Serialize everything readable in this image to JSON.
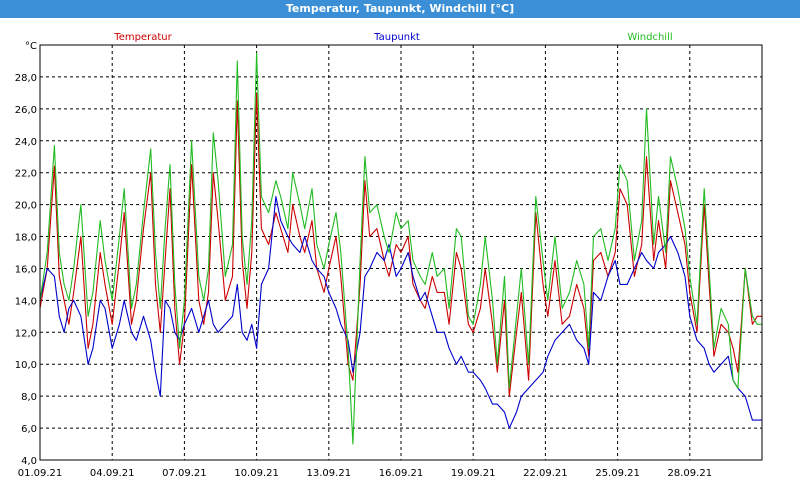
{
  "window": {
    "title": "Temperatur, Taupunkt, Windchill [°C]"
  },
  "chart_data": {
    "type": "line",
    "unit": "°C",
    "ylim": [
      4.0,
      30.0
    ],
    "yticks": [
      "4,0",
      "6,0",
      "8,0",
      "10,0",
      "12,0",
      "14,0",
      "16,0",
      "18,0",
      "20,0",
      "22,0",
      "24,0",
      "26,0",
      "28,0"
    ],
    "xlim_days": [
      1,
      31
    ],
    "xticks": [
      "01.09.21",
      "04.09.21",
      "07.09.21",
      "10.09.21",
      "13.09.21",
      "16.09.21",
      "19.09.21",
      "22.09.21",
      "25.09.21",
      "28.09.21"
    ],
    "grid": true,
    "legend_placement": "top",
    "series": [
      {
        "name": "Temperatur",
        "color": "#cc0000",
        "x": [
          1.0,
          1.3,
          1.6,
          1.8,
          2.0,
          2.2,
          2.4,
          2.7,
          3.0,
          3.2,
          3.5,
          3.7,
          4.0,
          4.3,
          4.5,
          4.8,
          5.0,
          5.3,
          5.6,
          5.8,
          6.0,
          6.2,
          6.4,
          6.6,
          6.8,
          7.0,
          7.3,
          7.6,
          7.8,
          8.0,
          8.2,
          8.4,
          8.7,
          9.0,
          9.2,
          9.4,
          9.6,
          9.8,
          10.0,
          10.2,
          10.5,
          10.8,
          11.0,
          11.3,
          11.5,
          11.8,
          12.0,
          12.3,
          12.5,
          12.8,
          13.0,
          13.3,
          13.5,
          13.8,
          14.0,
          14.3,
          14.5,
          14.7,
          15.0,
          15.3,
          15.5,
          15.8,
          16.0,
          16.3,
          16.5,
          16.8,
          17.0,
          17.3,
          17.5,
          17.8,
          18.0,
          18.3,
          18.5,
          18.8,
          19.0,
          19.3,
          19.5,
          19.8,
          20.0,
          20.3,
          20.5,
          20.8,
          21.0,
          21.3,
          21.6,
          21.9,
          22.1,
          22.4,
          22.7,
          23.0,
          23.3,
          23.6,
          23.8,
          24.0,
          24.3,
          24.6,
          24.9,
          25.1,
          25.4,
          25.7,
          26.0,
          26.2,
          26.5,
          26.7,
          27.0,
          27.2,
          27.5,
          27.8,
          28.0,
          28.3,
          28.6,
          28.8,
          29.0,
          29.3,
          29.6,
          29.8,
          30.0,
          30.3,
          30.6,
          30.8,
          31.0
        ],
        "y": [
          13.5,
          16.0,
          22.4,
          15.5,
          14.0,
          12.5,
          14.5,
          18.0,
          11.0,
          12.5,
          17.0,
          15.0,
          12.5,
          16.5,
          19.5,
          12.5,
          14.0,
          18.5,
          22.0,
          15.0,
          12.0,
          16.5,
          21.0,
          13.5,
          10.0,
          12.5,
          22.5,
          14.0,
          12.5,
          14.5,
          22.0,
          19.0,
          14.0,
          15.5,
          26.5,
          16.5,
          13.5,
          17.0,
          27.0,
          18.5,
          17.5,
          19.5,
          18.5,
          17.0,
          20.0,
          18.0,
          17.0,
          19.0,
          16.0,
          14.5,
          16.0,
          18.0,
          15.5,
          10.0,
          9.0,
          15.0,
          21.5,
          18.0,
          18.5,
          16.5,
          15.5,
          17.5,
          17.0,
          18.0,
          15.0,
          14.0,
          13.5,
          15.5,
          14.5,
          14.5,
          12.5,
          17.0,
          16.0,
          12.5,
          12.0,
          13.5,
          16.0,
          12.5,
          9.5,
          14.0,
          8.0,
          12.0,
          14.5,
          9.0,
          19.5,
          15.0,
          13.0,
          16.5,
          12.5,
          13.0,
          15.0,
          13.5,
          10.5,
          16.5,
          17.0,
          15.5,
          17.0,
          21.0,
          20.0,
          15.5,
          17.5,
          23.0,
          16.5,
          19.0,
          16.0,
          21.5,
          19.5,
          17.5,
          14.5,
          12.0,
          20.0,
          15.0,
          10.5,
          12.5,
          12.0,
          11.0,
          9.5,
          16.0,
          12.5,
          13.0,
          13.0
        ]
      },
      {
        "name": "Taupunkt",
        "color": "#0000cc",
        "x": [
          1.0,
          1.3,
          1.6,
          1.8,
          2.0,
          2.2,
          2.4,
          2.7,
          3.0,
          3.2,
          3.5,
          3.7,
          4.0,
          4.3,
          4.5,
          4.8,
          5.0,
          5.3,
          5.6,
          5.8,
          6.0,
          6.2,
          6.4,
          6.6,
          6.8,
          7.0,
          7.3,
          7.6,
          7.8,
          8.0,
          8.2,
          8.4,
          8.7,
          9.0,
          9.2,
          9.4,
          9.6,
          9.8,
          10.0,
          10.2,
          10.5,
          10.8,
          11.0,
          11.3,
          11.5,
          11.8,
          12.0,
          12.3,
          12.5,
          12.8,
          13.0,
          13.3,
          13.5,
          13.8,
          14.0,
          14.3,
          14.5,
          14.7,
          15.0,
          15.3,
          15.5,
          15.8,
          16.0,
          16.3,
          16.5,
          16.8,
          17.0,
          17.3,
          17.5,
          17.8,
          18.0,
          18.3,
          18.5,
          18.8,
          19.0,
          19.3,
          19.5,
          19.8,
          20.0,
          20.3,
          20.5,
          20.8,
          21.0,
          21.3,
          21.6,
          21.9,
          22.1,
          22.4,
          22.7,
          23.0,
          23.3,
          23.6,
          23.8,
          24.0,
          24.3,
          24.6,
          24.9,
          25.1,
          25.4,
          25.7,
          26.0,
          26.2,
          26.5,
          26.7,
          27.0,
          27.2,
          27.5,
          27.8,
          28.0,
          28.3,
          28.6,
          28.8,
          29.0,
          29.3,
          29.6,
          29.8,
          30.0,
          30.3,
          30.6,
          30.8,
          31.0
        ],
        "y": [
          14.0,
          16.0,
          15.5,
          13.0,
          12.0,
          13.5,
          14.0,
          13.0,
          10.0,
          11.0,
          14.0,
          13.5,
          11.0,
          12.5,
          14.0,
          12.0,
          11.5,
          13.0,
          11.5,
          9.5,
          8.0,
          14.0,
          13.5,
          12.0,
          11.5,
          12.5,
          13.5,
          12.0,
          13.0,
          14.0,
          12.5,
          12.0,
          12.5,
          13.0,
          15.0,
          12.0,
          11.5,
          12.5,
          11.0,
          15.0,
          16.0,
          20.5,
          19.0,
          18.0,
          17.5,
          17.0,
          18.0,
          16.5,
          16.0,
          15.5,
          14.5,
          13.5,
          12.5,
          11.5,
          9.5,
          12.0,
          15.5,
          16.0,
          17.0,
          16.5,
          17.5,
          15.5,
          16.0,
          17.0,
          15.5,
          14.0,
          14.5,
          13.0,
          12.0,
          12.0,
          11.0,
          10.0,
          10.5,
          9.5,
          9.5,
          9.0,
          8.5,
          7.5,
          7.5,
          7.0,
          6.0,
          7.0,
          8.0,
          8.5,
          9.0,
          9.5,
          10.5,
          11.5,
          12.0,
          12.5,
          11.5,
          11.0,
          10.0,
          14.5,
          14.0,
          15.5,
          16.5,
          15.0,
          15.0,
          16.0,
          17.0,
          16.5,
          16.0,
          17.0,
          17.5,
          18.0,
          17.0,
          15.5,
          13.0,
          11.5,
          11.0,
          10.0,
          9.5,
          10.0,
          10.5,
          9.0,
          8.5,
          8.0,
          6.5,
          6.5,
          6.5
        ]
      },
      {
        "name": "Windchill",
        "color": "#22bb22",
        "x": [
          1.0,
          1.3,
          1.6,
          1.8,
          2.0,
          2.2,
          2.4,
          2.7,
          3.0,
          3.2,
          3.5,
          3.7,
          4.0,
          4.3,
          4.5,
          4.8,
          5.0,
          5.3,
          5.6,
          5.8,
          6.0,
          6.2,
          6.4,
          6.6,
          6.8,
          7.0,
          7.3,
          7.6,
          7.8,
          8.0,
          8.2,
          8.4,
          8.7,
          9.0,
          9.2,
          9.4,
          9.6,
          9.8,
          10.0,
          10.2,
          10.5,
          10.8,
          11.0,
          11.3,
          11.5,
          11.8,
          12.0,
          12.3,
          12.5,
          12.8,
          13.0,
          13.3,
          13.5,
          13.8,
          14.0,
          14.3,
          14.5,
          14.7,
          15.0,
          15.3,
          15.5,
          15.8,
          16.0,
          16.3,
          16.5,
          16.8,
          17.0,
          17.3,
          17.5,
          17.8,
          18.0,
          18.3,
          18.5,
          18.8,
          19.0,
          19.3,
          19.5,
          19.8,
          20.0,
          20.3,
          20.5,
          20.8,
          21.0,
          21.3,
          21.6,
          21.9,
          22.1,
          22.4,
          22.7,
          23.0,
          23.3,
          23.6,
          23.8,
          24.0,
          24.3,
          24.6,
          24.9,
          25.1,
          25.4,
          25.7,
          26.0,
          26.2,
          26.5,
          26.7,
          27.0,
          27.2,
          27.5,
          27.8,
          28.0,
          28.3,
          28.6,
          28.8,
          29.0,
          29.3,
          29.6,
          29.8,
          30.0,
          30.3,
          30.6,
          30.8,
          31.0
        ],
        "y": [
          14.0,
          17.0,
          23.7,
          17.0,
          15.0,
          14.0,
          16.0,
          20.0,
          13.0,
          14.5,
          19.0,
          16.5,
          14.0,
          18.0,
          21.0,
          13.5,
          15.0,
          19.5,
          23.5,
          17.0,
          13.5,
          18.5,
          22.5,
          15.0,
          11.0,
          14.0,
          24.0,
          15.5,
          14.0,
          16.0,
          24.5,
          21.5,
          15.5,
          17.5,
          29.0,
          18.0,
          15.0,
          19.0,
          29.5,
          20.5,
          19.5,
          21.5,
          20.5,
          18.5,
          22.0,
          20.0,
          18.5,
          21.0,
          17.5,
          16.0,
          17.5,
          19.5,
          17.0,
          11.0,
          5.0,
          16.5,
          23.0,
          19.5,
          20.0,
          18.0,
          17.0,
          19.5,
          18.5,
          19.0,
          16.5,
          15.5,
          15.0,
          17.0,
          15.5,
          16.0,
          13.5,
          18.5,
          18.0,
          13.0,
          12.5,
          15.0,
          18.0,
          14.0,
          10.0,
          15.5,
          8.5,
          13.0,
          16.0,
          10.0,
          20.5,
          16.5,
          14.0,
          18.0,
          13.5,
          14.5,
          16.5,
          15.0,
          11.0,
          18.0,
          18.5,
          16.5,
          18.5,
          22.5,
          21.5,
          16.5,
          19.0,
          26.0,
          17.5,
          20.5,
          17.0,
          23.0,
          21.0,
          18.5,
          15.5,
          12.5,
          21.0,
          16.0,
          11.0,
          13.5,
          12.5,
          9.0,
          8.5,
          16.0,
          13.0,
          12.5,
          12.5
        ]
      }
    ]
  }
}
